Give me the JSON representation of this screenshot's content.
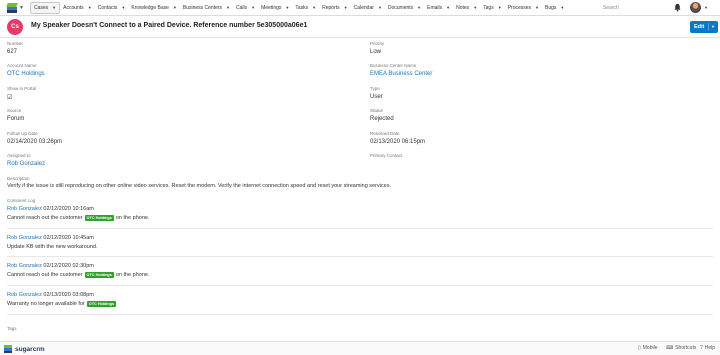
{
  "nav": {
    "items": [
      {
        "label": "Cases",
        "active": true
      },
      {
        "label": "Accounts"
      },
      {
        "label": "Contacts"
      },
      {
        "label": "Knowledge Base"
      },
      {
        "label": "Business Centers"
      },
      {
        "label": "Calls"
      },
      {
        "label": "Meetings"
      },
      {
        "label": "Tasks"
      },
      {
        "label": "Reports"
      },
      {
        "label": "Calendar"
      },
      {
        "label": "Documents"
      },
      {
        "label": "Emails"
      },
      {
        "label": "Notes"
      },
      {
        "label": "Tags"
      },
      {
        "label": "Processes"
      },
      {
        "label": "Bugs"
      }
    ],
    "search_placeholder": "Search"
  },
  "header": {
    "badge": "Cs",
    "title": "My Speaker Doesn't Connect to a Paired Device. Reference number 5e305000a06e1",
    "edit_label": "Edit"
  },
  "fields": {
    "number": {
      "label": "Number",
      "value": "627"
    },
    "priority": {
      "label": "Priority",
      "value": "Low"
    },
    "account_name": {
      "label": "Account Name",
      "value": "OTC Holdings"
    },
    "business_center": {
      "label": "Business Center Name",
      "value": "EMEA Business Center"
    },
    "show_in_portal": {
      "label": "Show in Portal",
      "value": "☑"
    },
    "type": {
      "label": "Type",
      "value": "User"
    },
    "source": {
      "label": "Source",
      "value": "Forum"
    },
    "status": {
      "label": "Status",
      "value": "Rejected"
    },
    "follow_up": {
      "label": "Follow Up Date",
      "value": "02/14/2020 03:26pm"
    },
    "resolved": {
      "label": "Resolved Date",
      "value": "02/13/2020 06:15pm"
    },
    "assigned_to": {
      "label": "Assigned to",
      "value": "Rob Gonzalez"
    },
    "primary_contact": {
      "label": "Primary Contact",
      "value": ""
    }
  },
  "description": {
    "label": "Description",
    "text": "Verify if the issue is still reproducing on other online video services. Reset the modem. Verify the internet connection speed and reset your streaming services."
  },
  "comment_log": {
    "label": "Comment Log",
    "entries": [
      {
        "author": "Rob Gonzalez",
        "date": "02/12/2020 10:16am",
        "pre": "Cannot reach out the customer",
        "tag": "OTC Holdings",
        "post": "on the phone."
      },
      {
        "author": "Rob Gonzalez",
        "date": "02/12/2020 10:45am",
        "pre": "Update KB with the new workaround.",
        "tag": "",
        "post": ""
      },
      {
        "author": "Rob Gonzalez",
        "date": "02/12/2020 02:30pm",
        "pre": "Cannot reach out the customer",
        "tag": "OTC Holdings",
        "post": "on the phone."
      },
      {
        "author": "Rob Gonzalez",
        "date": "02/13/2020 03:08pm",
        "pre": "Warranty no longer available for",
        "tag": "OTC Holdings",
        "post": ""
      }
    ]
  },
  "tags": {
    "label": "Tags"
  },
  "footer": {
    "brand": "sugarcrm",
    "mobile": "Mobile",
    "shortcuts": "Shortcuts",
    "help": "Help"
  },
  "colors": {
    "accent": "#0679c8",
    "badge": "#e33c66",
    "tag": "#33a02c",
    "link": "#1a73c1"
  }
}
